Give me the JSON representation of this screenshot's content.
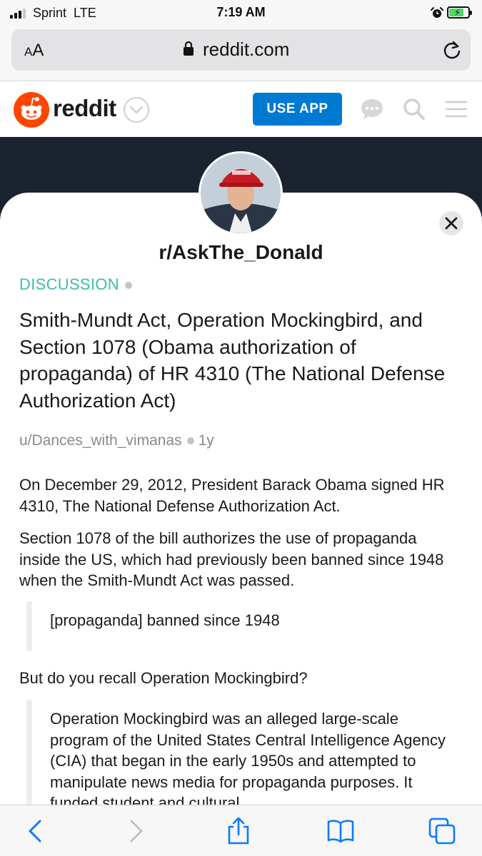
{
  "status_bar": {
    "carrier": "Sprint",
    "network": "LTE",
    "time": "7:19 AM",
    "signal_bars": 3,
    "battery_level": 0.72
  },
  "browser": {
    "text_size_label": "AA",
    "url": "reddit.com"
  },
  "reddit_header": {
    "wordmark": "reddit",
    "use_app_label": "USE APP",
    "brand_color": "#ff4500",
    "button_color": "#0079d3"
  },
  "subreddit": {
    "name": "r/AskThe_Donald",
    "banner_color": "#1c2330"
  },
  "post": {
    "flair": "DISCUSSION",
    "flair_color": "#3bbfa6",
    "title": "Smith-Mundt Act, Operation Mockingbird, and Section 1078 (Obama authorization of propaganda) of HR 4310 (The National Defense Authorization Act)",
    "author": "u/Dances_with_vimanas",
    "age": "1y",
    "body": {
      "p1": "On December 29, 2012, President Barack Obama signed HR 4310, The National Defense Authorization Act.",
      "p2": "Section 1078 of the bill authorizes the use of propaganda inside the US, which had previously been banned since 1948 when the Smith-Mundt Act was passed.",
      "quote1": "[propaganda] banned since 1948",
      "p3": "But do you recall Operation Mockingbird?",
      "quote2": "Operation Mockingbird was an alleged large-scale program of the United States Central Intelligence Agency (CIA) that began in the early 1950s and attempted to manipulate news media for propaganda purposes. It funded student and cultural"
    }
  },
  "toolbar": {
    "icons": [
      "back-icon",
      "forward-icon",
      "share-icon",
      "bookmarks-icon",
      "tabs-icon"
    ]
  }
}
